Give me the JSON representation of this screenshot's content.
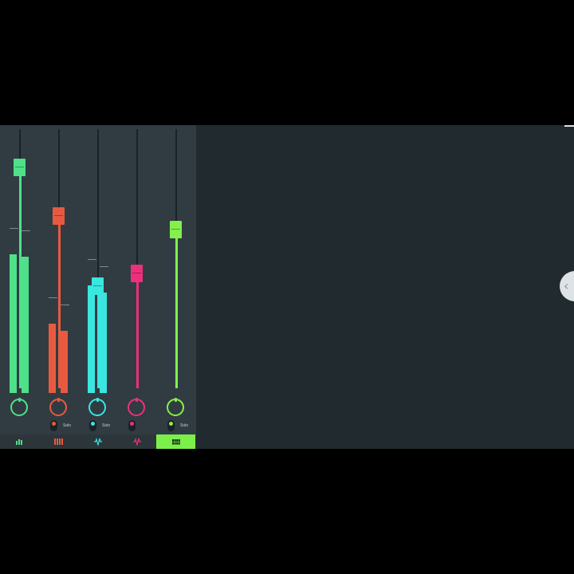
{
  "mixer": {
    "channels": [
      {
        "id": "ch1",
        "color": "#4fe08a",
        "fader_level": 0.9,
        "meter_left": 0.58,
        "meter_right": 0.57,
        "knob_color": "#4fe08a",
        "solo_label": "",
        "led_color": ""
      },
      {
        "id": "ch2",
        "color": "#e85a40",
        "fader_level": 0.71,
        "meter_left": 0.29,
        "meter_right": 0.26,
        "knob_color": "#e85a40",
        "solo_label": "Solo",
        "led_color": "#e85a40"
      },
      {
        "id": "ch3",
        "color": "#39e6e0",
        "fader_level": 0.44,
        "meter_left": 0.45,
        "meter_right": 0.42,
        "knob_color": "#39e6e0",
        "solo_label": "Solo",
        "led_color": "#39e6e0"
      },
      {
        "id": "ch4",
        "color": "#ee2f7c",
        "fader_level": 0.49,
        "meter_left": 0,
        "meter_right": 0,
        "knob_color": "#ee2f7c",
        "solo_label": "",
        "led_color": "#ee2f7c"
      },
      {
        "id": "ch5",
        "color": "#84f04c",
        "fader_level": 0.66,
        "meter_left": 0,
        "meter_right": 0,
        "knob_color": "#84f04c",
        "solo_label": "Solo",
        "led_color": "#84f04c"
      }
    ]
  },
  "tabs": [
    {
      "id": "mixer",
      "icon": "bars-icon",
      "color": "#4fe08a",
      "active": false
    },
    {
      "id": "piano",
      "icon": "piano-keys-icon",
      "color": "#e85a40",
      "active": false
    },
    {
      "id": "audio",
      "icon": "waveform-icon",
      "color": "#39e6e0",
      "active": false
    },
    {
      "id": "sampler",
      "icon": "waveform-icon",
      "color": "#ee2f7c",
      "active": false
    },
    {
      "id": "grid",
      "icon": "grid-icon",
      "color": "#1d2a20",
      "active": true
    }
  ],
  "side_handle": {
    "icon": "chevron-left-icon",
    "glyph": "‹"
  }
}
